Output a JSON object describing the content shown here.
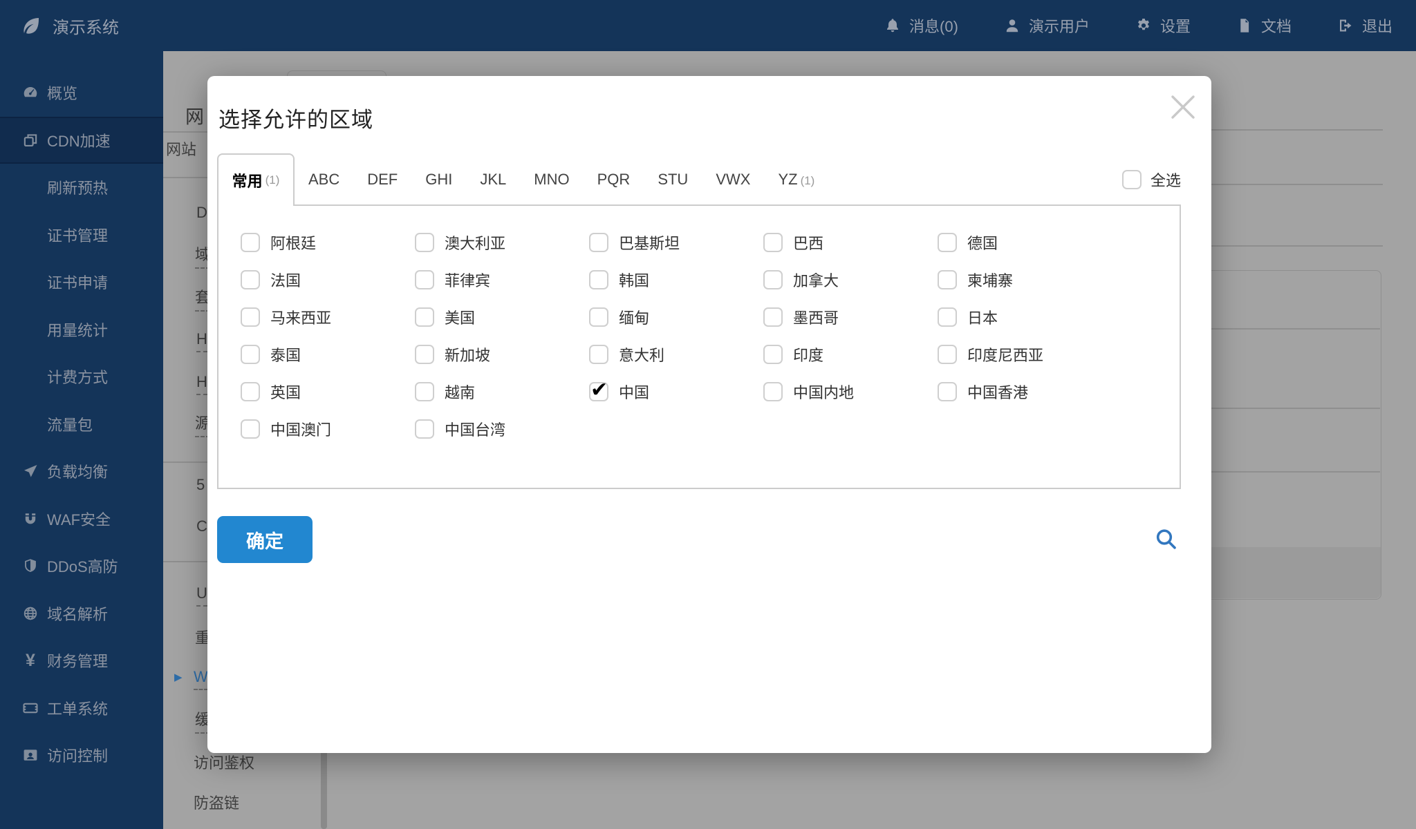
{
  "topbar": {
    "brand": "演示系统",
    "items": [
      {
        "label": "消息(0)",
        "icon": "bell"
      },
      {
        "label": "演示用户",
        "icon": "user"
      },
      {
        "label": "设置",
        "icon": "gear"
      },
      {
        "label": "文档",
        "icon": "doc"
      },
      {
        "label": "退出",
        "icon": "logout"
      }
    ]
  },
  "sidebar": {
    "items": [
      {
        "label": "概览",
        "icon": "gauge",
        "level": 1,
        "active": false
      },
      {
        "label": "CDN加速",
        "icon": "layers",
        "level": 1,
        "active": true
      },
      {
        "label": "刷新预热",
        "level": 2,
        "active": false
      },
      {
        "label": "证书管理",
        "level": 2,
        "active": false
      },
      {
        "label": "证书申请",
        "level": 2,
        "active": false
      },
      {
        "label": "用量统计",
        "level": 2,
        "active": false
      },
      {
        "label": "计费方式",
        "level": 2,
        "active": false
      },
      {
        "label": "流量包",
        "level": 2,
        "active": false
      },
      {
        "label": "负载均衡",
        "icon": "plane",
        "level": 1,
        "active": false
      },
      {
        "label": "WAF安全",
        "icon": "magnet",
        "level": 1,
        "active": false
      },
      {
        "label": "DDoS高防",
        "icon": "shield",
        "level": 1,
        "active": false
      },
      {
        "label": "域名解析",
        "icon": "globe",
        "level": 1,
        "active": false
      },
      {
        "label": "财务管理",
        "icon": "yen",
        "level": 1,
        "active": false
      },
      {
        "label": "工单系统",
        "icon": "ticket",
        "level": 1,
        "active": false
      },
      {
        "label": "访问控制",
        "icon": "idcard",
        "level": 1,
        "active": false
      }
    ]
  },
  "background": {
    "fragments": [
      {
        "text": "网",
        "kind": "heading"
      },
      {
        "text": "网站"
      },
      {
        "text": "D"
      },
      {
        "text": "域",
        "dashed": true
      },
      {
        "text": "套",
        "dashed": true
      },
      {
        "text": "H",
        "dashed": true
      },
      {
        "text": "H",
        "dashed": true
      },
      {
        "text": "源",
        "dashed": true
      },
      {
        "text": "5"
      },
      {
        "text": "C"
      },
      {
        "text": "U",
        "dashed": true
      },
      {
        "text": "重"
      },
      {
        "text": "W",
        "dashed": true,
        "blue": true,
        "arrow": true
      },
      {
        "text": "缓",
        "dashed": true
      },
      {
        "text": "访问鉴权"
      },
      {
        "text": "防盗链"
      }
    ],
    "arrow_glyph": "▶"
  },
  "modal": {
    "title": "选择允许的区域",
    "tabs": [
      {
        "label": "常用",
        "count": "(1)",
        "active": true
      },
      {
        "label": "ABC",
        "active": false
      },
      {
        "label": "DEF",
        "active": false
      },
      {
        "label": "GHI",
        "active": false
      },
      {
        "label": "JKL",
        "active": false
      },
      {
        "label": "MNO",
        "active": false
      },
      {
        "label": "PQR",
        "active": false
      },
      {
        "label": "STU",
        "active": false
      },
      {
        "label": "VWX",
        "active": false
      },
      {
        "label": "YZ",
        "count": "(1)",
        "active": false
      }
    ],
    "select_all_label": "全选",
    "select_all_checked": false,
    "regions": [
      {
        "label": "阿根廷",
        "checked": false
      },
      {
        "label": "澳大利亚",
        "checked": false
      },
      {
        "label": "巴基斯坦",
        "checked": false
      },
      {
        "label": "巴西",
        "checked": false
      },
      {
        "label": "德国",
        "checked": false
      },
      {
        "label": "法国",
        "checked": false
      },
      {
        "label": "菲律宾",
        "checked": false
      },
      {
        "label": "韩国",
        "checked": false
      },
      {
        "label": "加拿大",
        "checked": false
      },
      {
        "label": "柬埔寨",
        "checked": false
      },
      {
        "label": "马来西亚",
        "checked": false
      },
      {
        "label": "美国",
        "checked": false
      },
      {
        "label": "缅甸",
        "checked": false
      },
      {
        "label": "墨西哥",
        "checked": false
      },
      {
        "label": "日本",
        "checked": false
      },
      {
        "label": "泰国",
        "checked": false
      },
      {
        "label": "新加坡",
        "checked": false
      },
      {
        "label": "意大利",
        "checked": false
      },
      {
        "label": "印度",
        "checked": false
      },
      {
        "label": "印度尼西亚",
        "checked": false
      },
      {
        "label": "英国",
        "checked": false
      },
      {
        "label": "越南",
        "checked": false
      },
      {
        "label": "中国",
        "checked": true
      },
      {
        "label": "中国内地",
        "checked": false
      },
      {
        "label": "中国香港",
        "checked": false
      },
      {
        "label": "中国澳门",
        "checked": false
      },
      {
        "label": "中国台湾",
        "checked": false
      }
    ],
    "confirm_label": "确定",
    "check_glyph": "✔"
  },
  "colors": {
    "navy": "#143459",
    "sidebar_active": "#112c4e",
    "backdrop_gray": "#a3a3a3",
    "accent_blue": "#2287d0",
    "search_blue": "#3277bf",
    "link_blue": "#2e6da8",
    "border_gray": "#cccccc",
    "check_black": "#000000"
  }
}
